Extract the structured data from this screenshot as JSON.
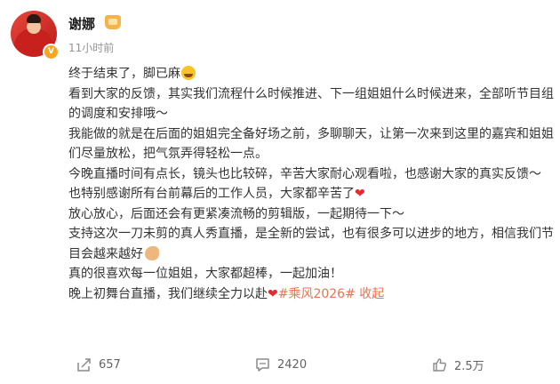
{
  "user": {
    "name": "谢娜",
    "time": "11小时前"
  },
  "post": {
    "lines": [
      "终于结束了，脚已麻",
      "看到大家的反馈，其实我们流程什么时候推进、下一组姐姐什么时候进来，全部听节目组的调度和安排哦～",
      "我能做的就是在后面的姐姐完全备好场之前，多聊聊天，让第一次来到这里的嘉宾和姐姐们尽量放松，把气氛弄得轻松一点。",
      "今晚直播时间有点长，镜头也比较碎，辛苦大家耐心观看啦，也感谢大家的真实反馈～",
      "也特别感谢所有台前幕后的工作人员，大家都辛苦了",
      "放心放心，后面还会有更紧凑流畅的剪辑版，一起期待一下～",
      "支持这次一刀未剪的真人秀直播，是全新的尝试，也有很多可以进步的地方，相信我们节目会越来越好",
      "真的很喜欢每一位姐姐，大家都超棒，一起加油！",
      "晚上初舞台直播，我们继续全力以赴"
    ],
    "hashtag": "#乘风2026#",
    "collapse": "收起"
  },
  "actions": {
    "share_count": "657",
    "comment_count": "2420",
    "like_count": "2.5万"
  },
  "icons": {
    "share": "share-icon",
    "comment": "comment-icon",
    "like": "thumbs-up-icon",
    "vip": "vip-crown-icon",
    "verified": "verified-badge-icon"
  },
  "colors": {
    "link": "#eb7350",
    "text": "#333333",
    "muted": "#939393",
    "heart": "#e8282e"
  }
}
